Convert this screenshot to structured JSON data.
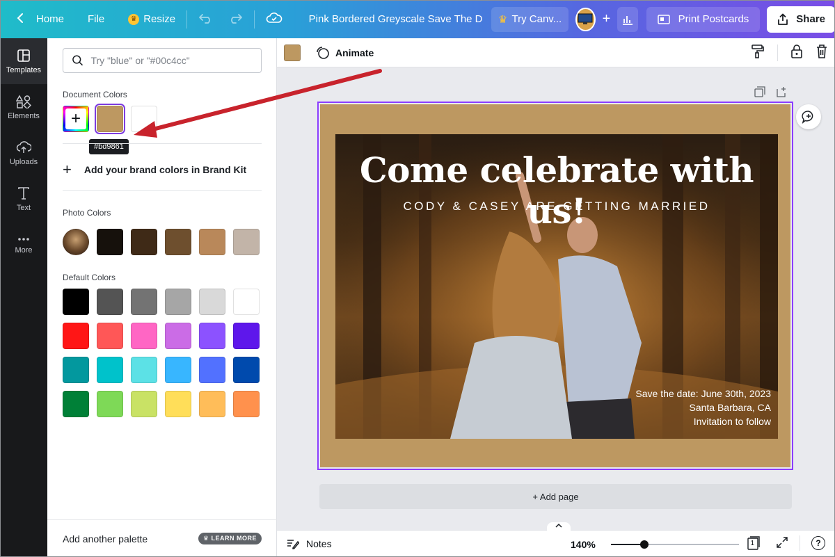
{
  "topbar": {
    "home": "Home",
    "file": "File",
    "resize": "Resize",
    "doc_title": "Pink Bordered Greyscale Save The Date P...",
    "try_canva": "Try Canv...",
    "print": "Print Postcards",
    "share": "Share"
  },
  "rail": {
    "items": [
      {
        "label": "Templates"
      },
      {
        "label": "Elements"
      },
      {
        "label": "Uploads"
      },
      {
        "label": "Text"
      },
      {
        "label": "More"
      }
    ]
  },
  "panel": {
    "search_placeholder": "Try \"blue\" or \"#00c4cc\"",
    "document_colors_title": "Document Colors",
    "document_colors": [
      "#bd9861",
      "#ffffff"
    ],
    "tooltip": "#bd9861",
    "brand_kit": "Add your brand colors in Brand Kit",
    "photo_colors_title": "Photo Colors",
    "photo_colors": [
      "#16110c",
      "#3f2a17",
      "#6e4f2e",
      "#b9885a",
      "#c2b4a8"
    ],
    "default_colors_title": "Default Colors",
    "default_colors": [
      "#000000",
      "#545454",
      "#737373",
      "#a6a6a6",
      "#d9d9d9",
      "#ffffff",
      "#ff1616",
      "#ff5757",
      "#ff66c4",
      "#cb6ce6",
      "#8c52ff",
      "#5e17eb",
      "#03989e",
      "#00c2cb",
      "#5ce1e6",
      "#38b6ff",
      "#5271ff",
      "#004aad",
      "#008037",
      "#7ed957",
      "#c9e265",
      "#ffde59",
      "#ffbd59",
      "#ff914d"
    ],
    "footer_label": "Add another palette",
    "learn_more": "LEARN MORE"
  },
  "toolbar": {
    "color": "#bd9861",
    "animate": "Animate"
  },
  "design": {
    "border_color": "#bd9861",
    "headline": "Come celebrate with us!",
    "subhead": "CODY & CASEY ARE GETTING MARRIED",
    "details": [
      "Save the date: June 30th, 2023",
      "Santa Barbara, CA",
      "Invitation to follow"
    ]
  },
  "canvas": {
    "add_page": "+ Add page"
  },
  "bottombar": {
    "notes": "Notes",
    "zoom": "140%",
    "zoom_fraction": 0.26,
    "page_count": "1",
    "help": "?"
  },
  "colors": {
    "accent": "#8b3dff",
    "annotation_arrow": "#c8232c"
  }
}
